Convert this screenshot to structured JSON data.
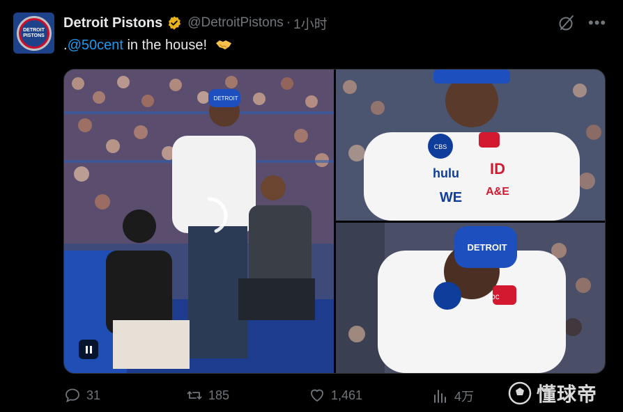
{
  "account": {
    "display_name": "Detroit Pistons",
    "handle": "@DetroitPistons",
    "separator": "·",
    "timestamp": "1小时",
    "avatar_text": "DETROIT PISTONS",
    "verified_color": "#e8b21b"
  },
  "tweet": {
    "prefix": ".",
    "mention": "@50cent",
    "text": " in the house!",
    "emoji": "handshake-emoji"
  },
  "media": {
    "photo_count": 3,
    "hat_text": "DETROIT",
    "shirt_logos": [
      "CBS",
      "hulu",
      "WE",
      "ID",
      "A&E",
      "abc"
    ],
    "playback": "pause"
  },
  "actions": {
    "replies": "31",
    "reposts": "185",
    "likes": "1,461",
    "views": "4万"
  },
  "watermark": {
    "text": "懂球帝"
  },
  "colors": {
    "background": "#000000",
    "text_primary": "#e7e9ea",
    "text_secondary": "#71767b",
    "link": "#1d9bf0",
    "pistons_blue": "#1d428a",
    "pistons_red": "#c8102e"
  }
}
